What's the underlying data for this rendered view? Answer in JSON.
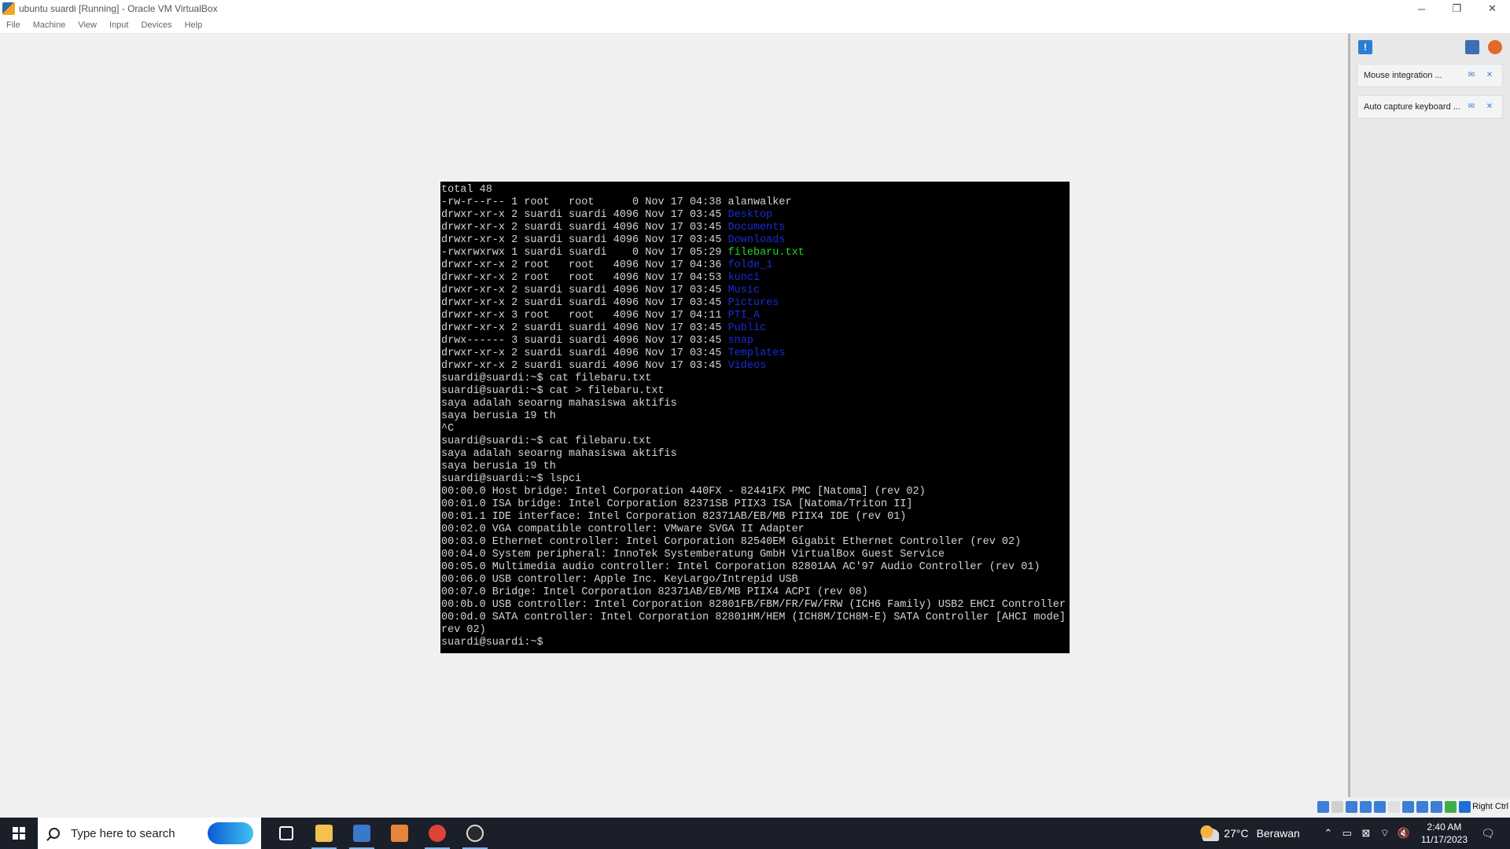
{
  "window": {
    "title": "ubuntu suardi [Running] - Oracle VM VirtualBox",
    "minimize": "─",
    "restore": "❐",
    "close": "✕"
  },
  "menu": [
    "File",
    "Machine",
    "View",
    "Input",
    "Devices",
    "Help"
  ],
  "terminal": {
    "lines": [
      [
        {
          "t": "total 48"
        }
      ],
      [
        {
          "t": "-rw-r--r-- 1 root   root      0 Nov 17 04:38 alanwalker"
        }
      ],
      [
        {
          "t": "drwxr-xr-x 2 suardi suardi 4096 Nov 17 03:45 "
        },
        {
          "t": "Desktop",
          "c": "blue"
        }
      ],
      [
        {
          "t": "drwxr-xr-x 2 suardi suardi 4096 Nov 17 03:45 "
        },
        {
          "t": "Documents",
          "c": "blue"
        }
      ],
      [
        {
          "t": "drwxr-xr-x 2 suardi suardi 4096 Nov 17 03:45 "
        },
        {
          "t": "Downloads",
          "c": "blue"
        }
      ],
      [
        {
          "t": "-rwxrwxrwx 1 suardi suardi    0 Nov 17 05:29 "
        },
        {
          "t": "filebaru.txt",
          "c": "green"
        }
      ],
      [
        {
          "t": "drwxr-xr-x 2 root   root   4096 Nov 17 04:36 "
        },
        {
          "t": "folde_1",
          "c": "blue"
        }
      ],
      [
        {
          "t": "drwxr-xr-x 2 root   root   4096 Nov 17 04:53 "
        },
        {
          "t": "kunci",
          "c": "blue"
        }
      ],
      [
        {
          "t": "drwxr-xr-x 2 suardi suardi 4096 Nov 17 03:45 "
        },
        {
          "t": "Music",
          "c": "blue"
        }
      ],
      [
        {
          "t": "drwxr-xr-x 2 suardi suardi 4096 Nov 17 03:45 "
        },
        {
          "t": "Pictures",
          "c": "blue"
        }
      ],
      [
        {
          "t": "drwxr-xr-x 3 root   root   4096 Nov 17 04:11 "
        },
        {
          "t": "PTI_A",
          "c": "blue"
        }
      ],
      [
        {
          "t": "drwxr-xr-x 2 suardi suardi 4096 Nov 17 03:45 "
        },
        {
          "t": "Public",
          "c": "blue"
        }
      ],
      [
        {
          "t": "drwx------ 3 suardi suardi 4096 Nov 17 03:45 "
        },
        {
          "t": "snap",
          "c": "blue"
        }
      ],
      [
        {
          "t": "drwxr-xr-x 2 suardi suardi 4096 Nov 17 03:45 "
        },
        {
          "t": "Templates",
          "c": "blue"
        }
      ],
      [
        {
          "t": "drwxr-xr-x 2 suardi suardi 4096 Nov 17 03:45 "
        },
        {
          "t": "Videos",
          "c": "blue"
        }
      ],
      [
        {
          "t": "suardi@suardi:~$ cat filebaru.txt"
        }
      ],
      [
        {
          "t": "suardi@suardi:~$ cat > filebaru.txt"
        }
      ],
      [
        {
          "t": "saya adalah seoarng mahasiswa aktifis"
        }
      ],
      [
        {
          "t": "saya berusia 19 th"
        }
      ],
      [
        {
          "t": "^C"
        }
      ],
      [
        {
          "t": "suardi@suardi:~$ cat filebaru.txt"
        }
      ],
      [
        {
          "t": "saya adalah seoarng mahasiswa aktifis"
        }
      ],
      [
        {
          "t": "saya berusia 19 th"
        }
      ],
      [
        {
          "t": "suardi@suardi:~$ lspci"
        }
      ],
      [
        {
          "t": "00:00.0 Host bridge: Intel Corporation 440FX - 82441FX PMC [Natoma] (rev 02)"
        }
      ],
      [
        {
          "t": "00:01.0 ISA bridge: Intel Corporation 82371SB PIIX3 ISA [Natoma/Triton II]"
        }
      ],
      [
        {
          "t": "00:01.1 IDE interface: Intel Corporation 82371AB/EB/MB PIIX4 IDE (rev 01)"
        }
      ],
      [
        {
          "t": "00:02.0 VGA compatible controller: VMware SVGA II Adapter"
        }
      ],
      [
        {
          "t": "00:03.0 Ethernet controller: Intel Corporation 82540EM Gigabit Ethernet Controller (rev 02)"
        }
      ],
      [
        {
          "t": "00:04.0 System peripheral: InnoTek Systemberatung GmbH VirtualBox Guest Service"
        }
      ],
      [
        {
          "t": "00:05.0 Multimedia audio controller: Intel Corporation 82801AA AC'97 Audio Controller (rev 01)"
        }
      ],
      [
        {
          "t": "00:06.0 USB controller: Apple Inc. KeyLargo/Intrepid USB"
        }
      ],
      [
        {
          "t": "00:07.0 Bridge: Intel Corporation 82371AB/EB/MB PIIX4 ACPI (rev 08)"
        }
      ],
      [
        {
          "t": "00:0b.0 USB controller: Intel Corporation 82801FB/FBM/FR/FW/FRW (ICH6 Family) USB2 EHCI Controller"
        }
      ],
      [
        {
          "t": "00:0d.0 SATA controller: Intel Corporation 82801HM/HEM (ICH8M/ICH8M-E) SATA Controller [AHCI mode] ("
        }
      ],
      [
        {
          "t": "rev 02)"
        }
      ],
      [
        {
          "t": "suardi@suardi:~$ "
        }
      ]
    ]
  },
  "notifications": [
    {
      "text": "Mouse integration ..."
    },
    {
      "text": "Auto capture keyboard ..."
    }
  ],
  "statusbar": {
    "host_key": "Right Ctrl",
    "icon_colors": [
      "#3b7fd6",
      "#cfcfcf",
      "#3b7fd6",
      "#3b7fd6",
      "#3b7fd6",
      "#e0e0e0",
      "#3b7fd6",
      "#3b7fd6",
      "#3b7fd6",
      "#3fae49",
      "#1e6ed8"
    ]
  },
  "taskbar": {
    "search_placeholder": "Type here to search",
    "apps": [
      {
        "name": "task-view-icon",
        "color": "#1b1f2a",
        "open": false
      },
      {
        "name": "file-explorer-icon",
        "color": "#f2c14e",
        "open": true
      },
      {
        "name": "virtualbox-icon",
        "color": "#3a78c9",
        "open": true
      },
      {
        "name": "sublime-icon",
        "color": "#e8833a",
        "open": false
      },
      {
        "name": "chrome-icon",
        "color": "#db4437",
        "open": true
      },
      {
        "name": "obs-icon",
        "color": "#2b2b2b",
        "open": true
      }
    ],
    "weather": {
      "temp": "27°C",
      "desc": "Berawan"
    },
    "tray_icons": [
      "⌃",
      "▭",
      "⊠",
      "⌔",
      "🔇"
    ],
    "clock": {
      "time": "2:40 AM",
      "date": "11/17/2023"
    },
    "notification_glyph": "🗨"
  }
}
